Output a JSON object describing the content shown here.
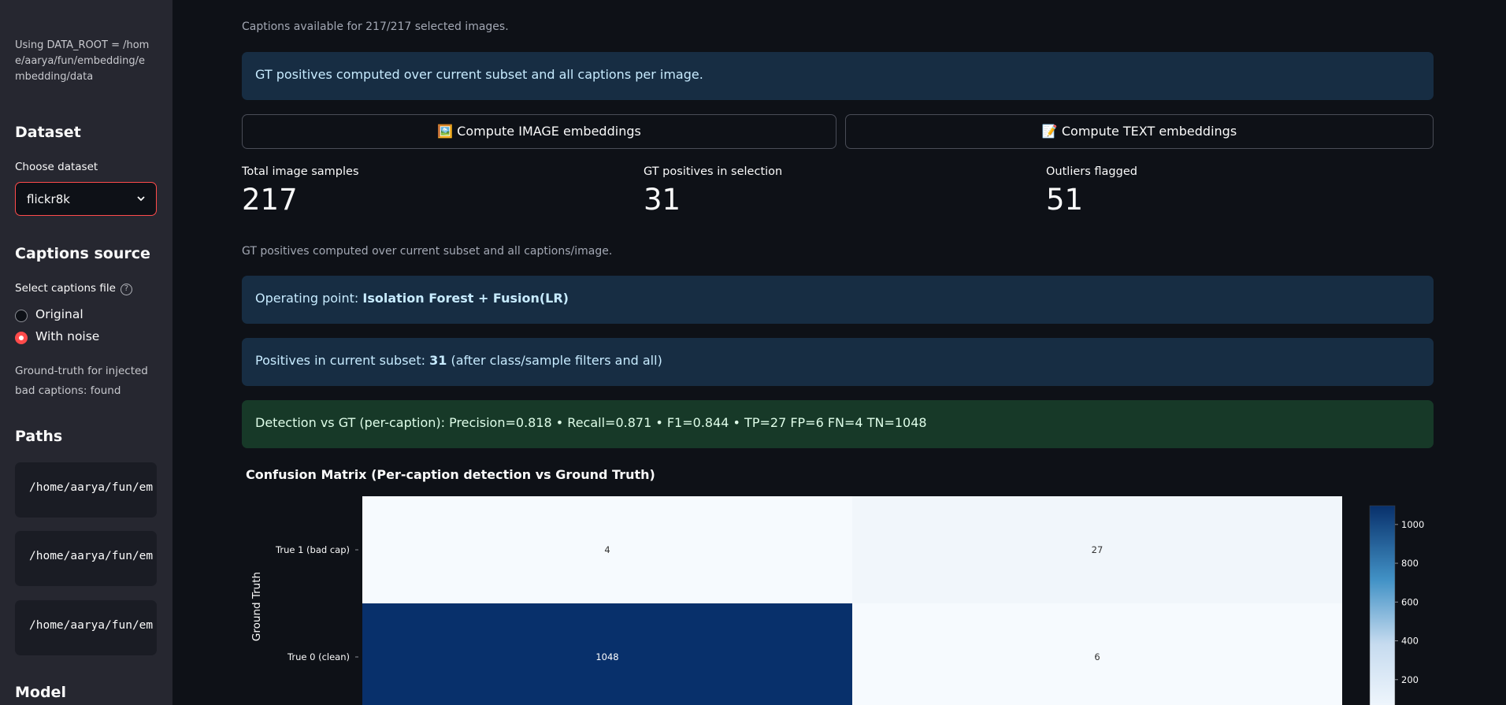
{
  "sidebar": {
    "data_root_note": "Using DATA_ROOT = /home/aarya/fun/embedding/embedding/data",
    "dataset": {
      "heading": "Dataset",
      "label": "Choose dataset",
      "value": "flickr8k"
    },
    "captions": {
      "heading": "Captions source",
      "label": "Select captions file",
      "help": "?",
      "options": [
        {
          "label": "Original",
          "selected": false
        },
        {
          "label": "With noise",
          "selected": true
        }
      ],
      "gt_note": "Ground-truth for injected bad captions: found"
    },
    "paths": {
      "heading": "Paths",
      "values": [
        "/home/aarya/fun/em",
        "/home/aarya/fun/em",
        "/home/aarya/fun/em"
      ]
    },
    "model": {
      "heading": "Model"
    }
  },
  "main": {
    "captions_available": "Captions available for 217/217 selected images.",
    "info_gt": "GT positives computed over current subset and all captions per image.",
    "buttons": {
      "image": {
        "icon": "🖼️",
        "label": "Compute IMAGE embeddings"
      },
      "text": {
        "icon": "📝",
        "label": "Compute TEXT embeddings"
      }
    },
    "metrics": [
      {
        "label": "Total image samples",
        "value": "217"
      },
      {
        "label": "GT positives in selection",
        "value": "31"
      },
      {
        "label": "Outliers flagged",
        "value": "51"
      }
    ],
    "gt_caption": "GT positives computed over current subset and all captions/image.",
    "operating_point": {
      "prefix": "Operating point: ",
      "value": "Isolation Forest + Fusion(LR)"
    },
    "positives": {
      "prefix": "Positives in current subset: ",
      "value": "31",
      "suffix": " (after class/sample filters and all)"
    },
    "detection": "Detection vs GT (per-caption): Precision=0.818 • Recall=0.871 • F1=0.844 • TP=27 FP=6 FN=4 TN=1048"
  },
  "chart_data": {
    "type": "heatmap",
    "title": "Confusion Matrix (Per-caption detection vs Ground Truth)",
    "ylabel": "Ground Truth",
    "rows": [
      "True 1 (bad cap)",
      "True 0 (clean)"
    ],
    "values": [
      [
        4,
        27
      ],
      [
        1048,
        6
      ]
    ],
    "colorscale": [
      "#f7fbff",
      "#08306b"
    ],
    "zlim": [
      0,
      1048
    ],
    "colorbar_ticks": [
      1000,
      800,
      600,
      400,
      200
    ]
  },
  "colors": {
    "accent": "#ff4b4b",
    "info_bg": "#172d43",
    "success_bg": "#173928"
  }
}
